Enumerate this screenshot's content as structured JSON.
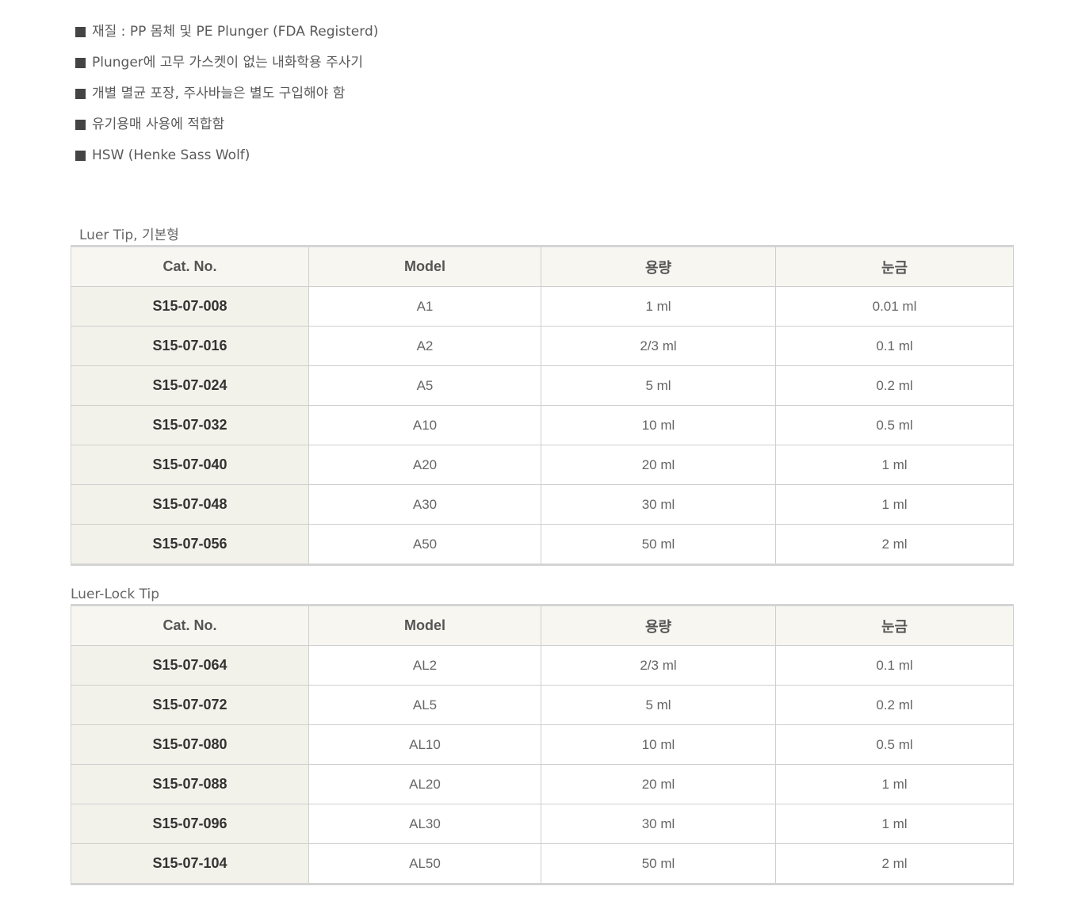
{
  "features": [
    "재질 : PP 몸체 및 PE Plunger (FDA Registerd)",
    "Plunger에 고무 가스켓이 없는 내화학용 주사기",
    "개별 멸균 포장, 주사바늘은 별도 구입해야 함",
    "유기용매 사용에 적합함",
    "HSW (Henke Sass Wolf)"
  ],
  "tables": [
    {
      "title": "Luer Tip, 기본형",
      "headers": [
        "Cat. No.",
        "Model",
        "용량",
        "눈금"
      ],
      "rows": [
        [
          "S15-07-008",
          "A1",
          "1 ml",
          "0.01 ml"
        ],
        [
          "S15-07-016",
          "A2",
          "2/3 ml",
          "0.1 ml"
        ],
        [
          "S15-07-024",
          "A5",
          "5 ml",
          "0.2 ml"
        ],
        [
          "S15-07-032",
          "A10",
          "10 ml",
          "0.5 ml"
        ],
        [
          "S15-07-040",
          "A20",
          "20 ml",
          "1 ml"
        ],
        [
          "S15-07-048",
          "A30",
          "30 ml",
          "1 ml"
        ],
        [
          "S15-07-056",
          "A50",
          "50 ml",
          "2 ml"
        ]
      ]
    },
    {
      "title": "Luer-Lock Tip",
      "headers": [
        "Cat. No.",
        "Model",
        "용량",
        "눈금"
      ],
      "rows": [
        [
          "S15-07-064",
          "AL2",
          "2/3 ml",
          "0.1 ml"
        ],
        [
          "S15-07-072",
          "AL5",
          "5 ml",
          "0.2 ml"
        ],
        [
          "S15-07-080",
          "AL10",
          "10 ml",
          "0.5 ml"
        ],
        [
          "S15-07-088",
          "AL20",
          "20 ml",
          "1 ml"
        ],
        [
          "S15-07-096",
          "AL30",
          "30 ml",
          "1 ml"
        ],
        [
          "S15-07-104",
          "AL50",
          "50 ml",
          "2 ml"
        ]
      ]
    }
  ]
}
